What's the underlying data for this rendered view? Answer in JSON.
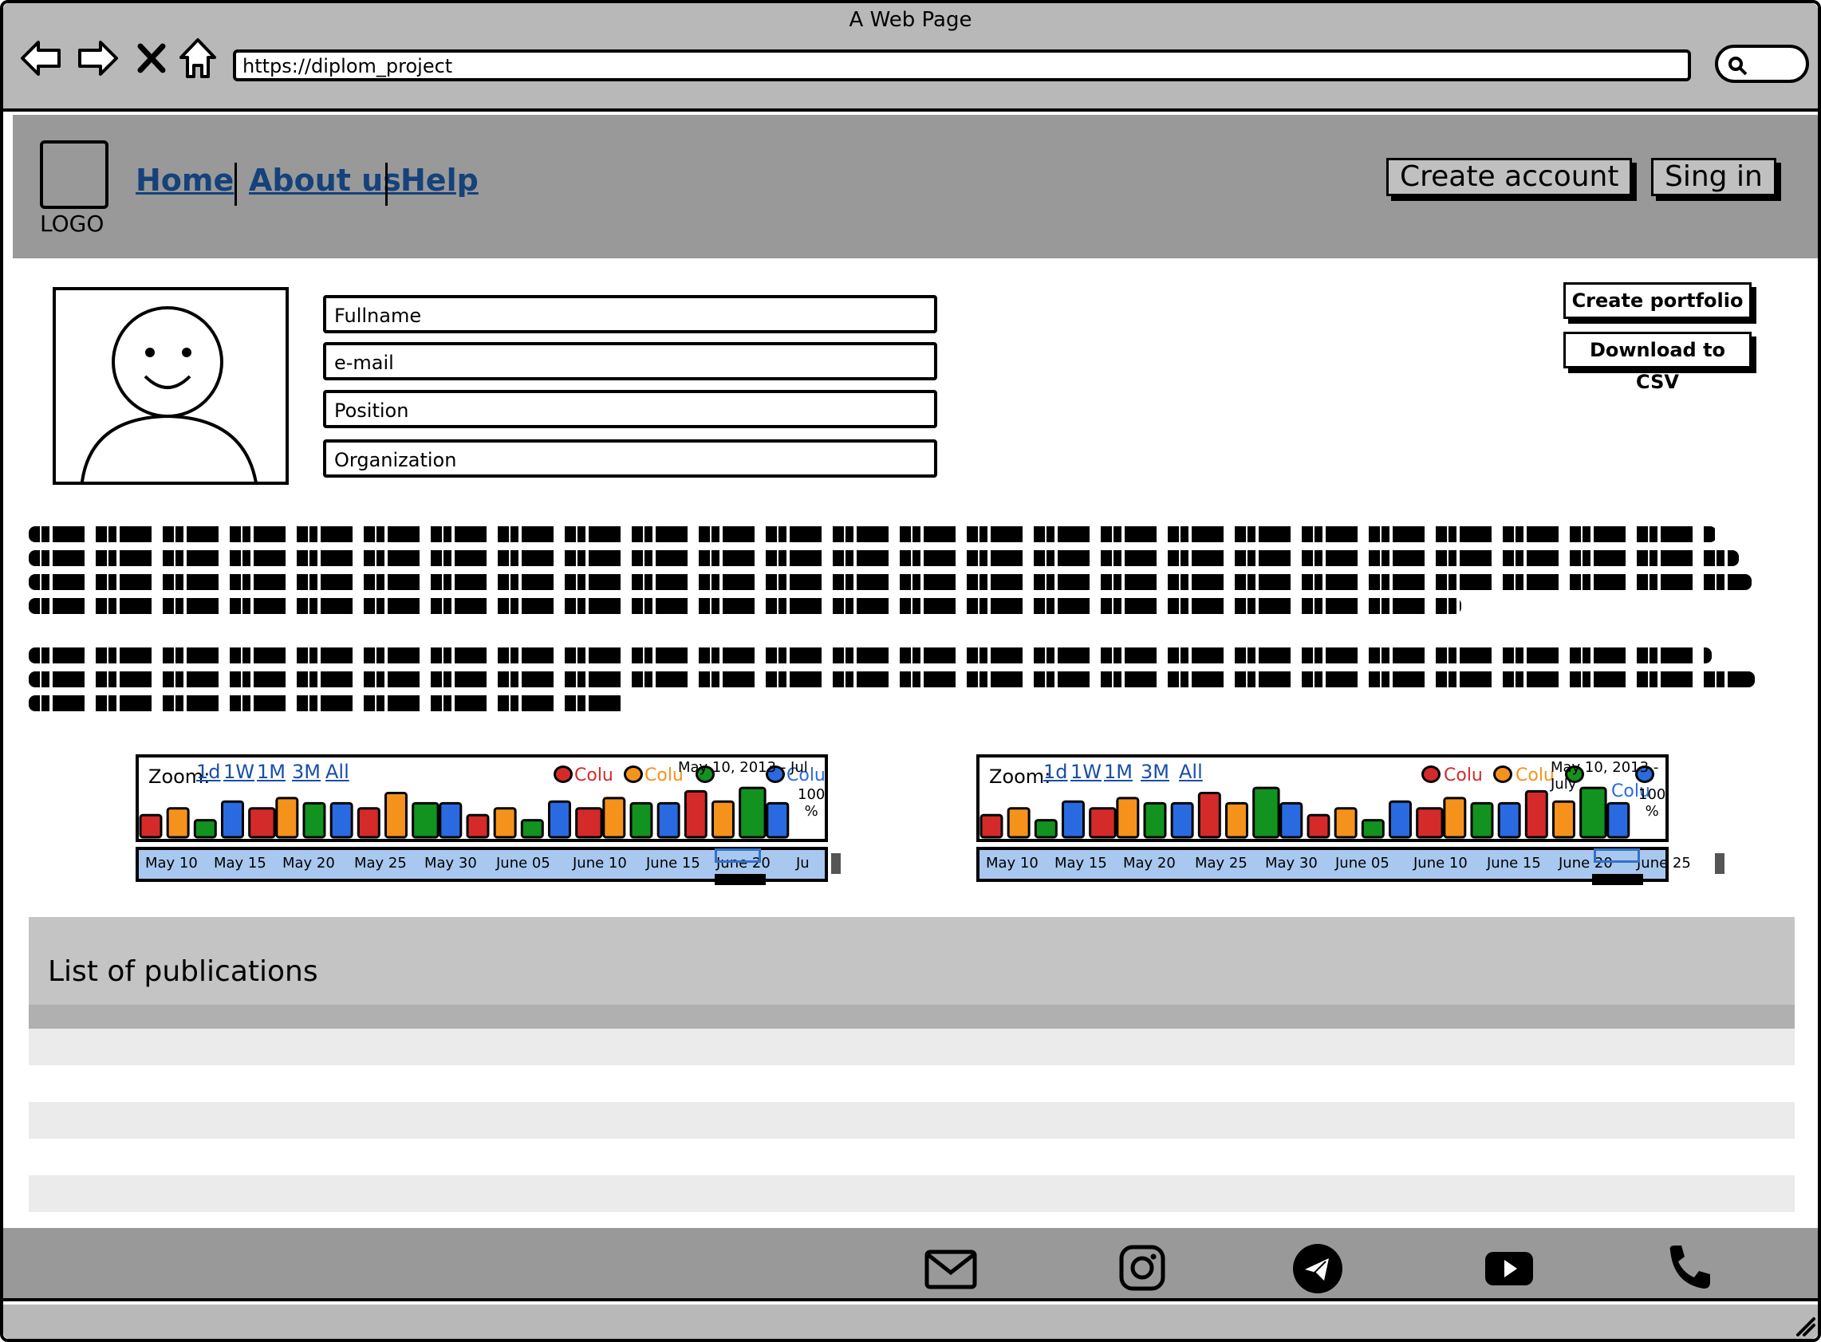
{
  "window": {
    "title": "A Web Page"
  },
  "address_bar": {
    "url": "https://diplom_project"
  },
  "header": {
    "logo_label": "LOGO",
    "nav": [
      "Home",
      "About us",
      "Help"
    ],
    "create_account_label": "Create account",
    "sign_in_label": "Sing in"
  },
  "profile": {
    "fields": [
      "Fullname",
      "e-mail",
      "Position",
      "Organization"
    ],
    "create_portfolio_label": "Create portfolio",
    "download_csv_label": "Download to CSV"
  },
  "chart_common": {
    "zoom_label": "Zoom:",
    "zoom_options": [
      "1d",
      "1W",
      "1M",
      "3M",
      "All"
    ],
    "legend_label": "Colu",
    "percent_label_top": "100",
    "percent_label_bottom": "%"
  },
  "chart_data": [
    {
      "type": "bar",
      "date_range_label": "May 10, 2013 - Jul",
      "x_ticks": [
        "May 10",
        "May 15",
        "May 20",
        "May 25",
        "May 30",
        "June 05",
        "June 10",
        "June 15",
        "June 20",
        "Ju"
      ],
      "values": [
        26,
        34,
        20,
        42,
        34,
        46,
        40,
        40,
        34,
        52,
        40,
        40,
        26,
        34,
        20,
        42,
        34,
        46,
        40,
        40,
        54,
        42,
        58,
        40
      ],
      "colors": [
        "red",
        "orange",
        "green",
        "blue",
        "red",
        "orange",
        "green",
        "blue",
        "red",
        "orange",
        "green",
        "blue",
        "red",
        "orange",
        "green",
        "blue",
        "red",
        "orange",
        "green",
        "blue",
        "red",
        "orange",
        "green",
        "blue"
      ]
    },
    {
      "type": "bar",
      "date_range_label": "May 10, 2013 - July",
      "x_ticks": [
        "May 10",
        "May 15",
        "May 20",
        "May 25",
        "May 30",
        "June 05",
        "June 10",
        "June 15",
        "June 20",
        "June 25"
      ],
      "values": [
        26,
        34,
        20,
        42,
        34,
        46,
        40,
        40,
        52,
        40,
        58,
        40,
        26,
        34,
        20,
        42,
        34,
        46,
        40,
        40,
        54,
        42,
        58,
        40
      ],
      "colors": [
        "red",
        "orange",
        "green",
        "blue",
        "red",
        "orange",
        "green",
        "blue",
        "red",
        "orange",
        "green",
        "blue",
        "red",
        "orange",
        "green",
        "blue",
        "red",
        "orange",
        "green",
        "blue",
        "red",
        "orange",
        "green",
        "blue"
      ]
    }
  ],
  "colors": {
    "red": "#d42a2a",
    "orange": "#f5921b",
    "green": "#12921e",
    "blue": "#2a6ae0"
  },
  "publications": {
    "title": "List of publications",
    "rows": 5
  },
  "footer": {
    "icons": [
      "mail-icon",
      "instagram-icon",
      "telegram-icon",
      "youtube-icon",
      "phone-icon"
    ]
  }
}
